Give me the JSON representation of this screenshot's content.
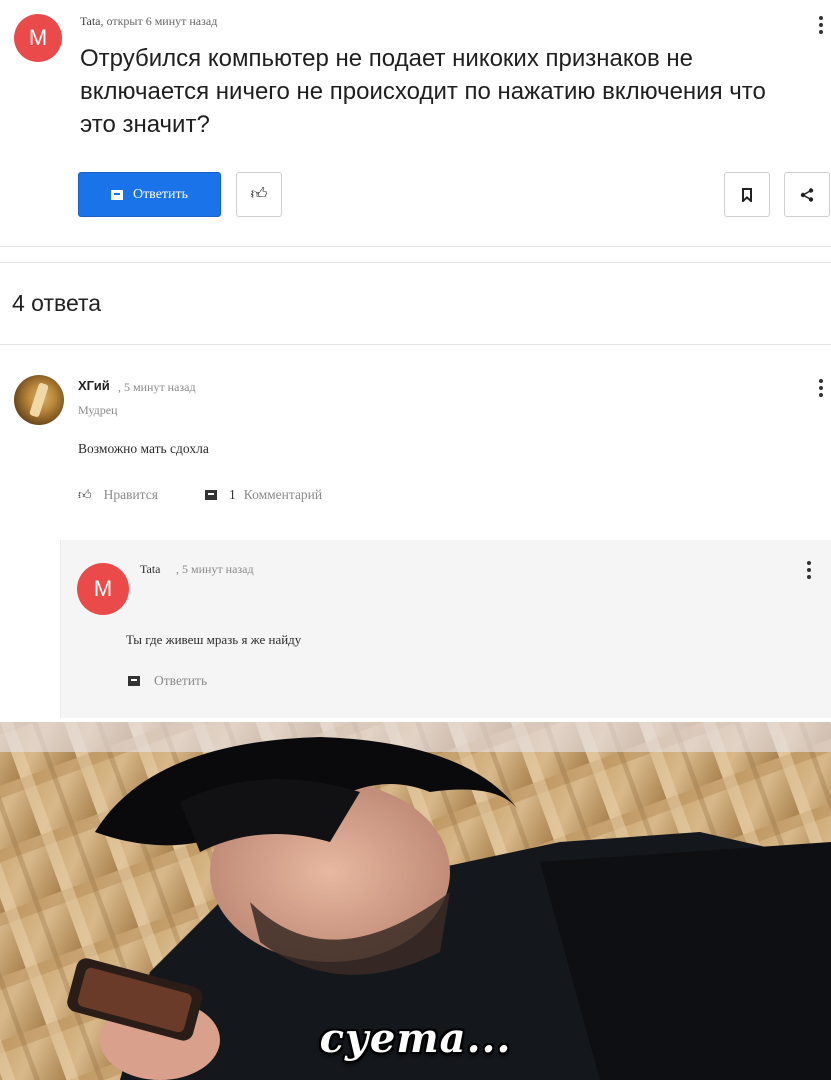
{
  "question": {
    "avatar_letter": "M",
    "author": "Tata",
    "meta_suffix": ", открыт 6 минут назад",
    "text": "Отрубился компьютер не подает никоких признаков не включается ничего не происходит по нажатию включения что это значит?",
    "reply_label": "Ответить",
    "icons": {
      "like": "thumbs-up-icon",
      "bookmark": "bookmark-icon",
      "share": "share-icon",
      "menu": "more-vertical-icon"
    }
  },
  "answers_header": "4 ответа",
  "answer": {
    "author": "ХГий",
    "time": ", 5 минут назад",
    "rank": "Мудрец",
    "text": "Возможно мать сдохла",
    "like_label": "Нравится",
    "comments_count": "1",
    "comments_label": "Комментарий"
  },
  "comment": {
    "avatar_letter": "M",
    "author": "Tata",
    "time": ", 5 минут назад",
    "text": "Ты где живеш мразь я же найду",
    "reply_label": "Ответить"
  },
  "meme": {
    "caption": "суета..."
  },
  "colors": {
    "accent": "#1a73e8",
    "avatar_red": "#ea4a4a",
    "muted_text": "#8a8a8a",
    "comment_bg": "#f5f5f5"
  }
}
